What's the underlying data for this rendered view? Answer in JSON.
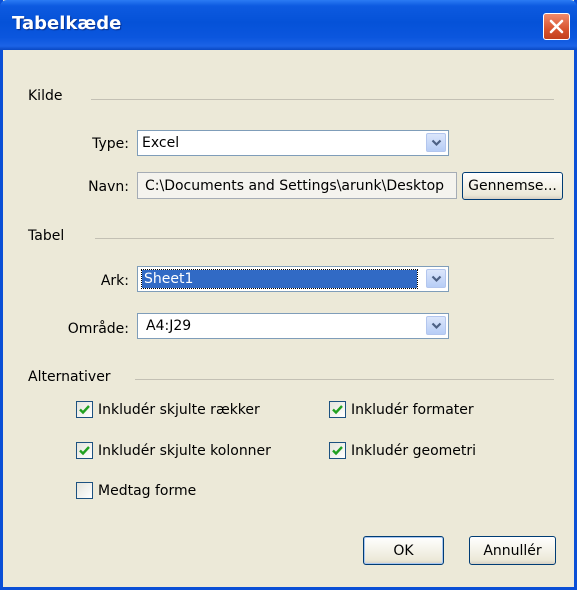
{
  "window": {
    "title": "Tabelkæde"
  },
  "source": {
    "heading": "Kilde",
    "type_label": "Type:",
    "type_value": "Excel",
    "name_label": "Navn:",
    "name_value": "C:\\Documents and Settings\\arunk\\Desktop",
    "browse_label": "Gennemse..."
  },
  "table": {
    "heading": "Tabel",
    "sheet_label": "Ark:",
    "sheet_value": "Sheet1",
    "range_label": "Område:",
    "range_value": "A4:J29"
  },
  "options": {
    "heading": "Alternativer",
    "items": [
      {
        "label": "Inkludér skjulte rækker",
        "checked": true
      },
      {
        "label": "Inkludér formater",
        "checked": true
      },
      {
        "label": "Inkludér skjulte kolonner",
        "checked": true
      },
      {
        "label": "Inkludér geometri",
        "checked": true
      },
      {
        "label": "Medtag forme",
        "checked": false
      }
    ]
  },
  "buttons": {
    "ok": "OK",
    "cancel": "Annullér"
  },
  "colors": {
    "titlebar": "#0552d8",
    "close": "#d8542f",
    "dialog_bg": "#ece9d8",
    "selection": "#316ac5",
    "check": "#21a121"
  },
  "icons": {
    "close": "close-icon",
    "dropdown": "chevron-down-icon",
    "check": "checkmark-icon"
  }
}
